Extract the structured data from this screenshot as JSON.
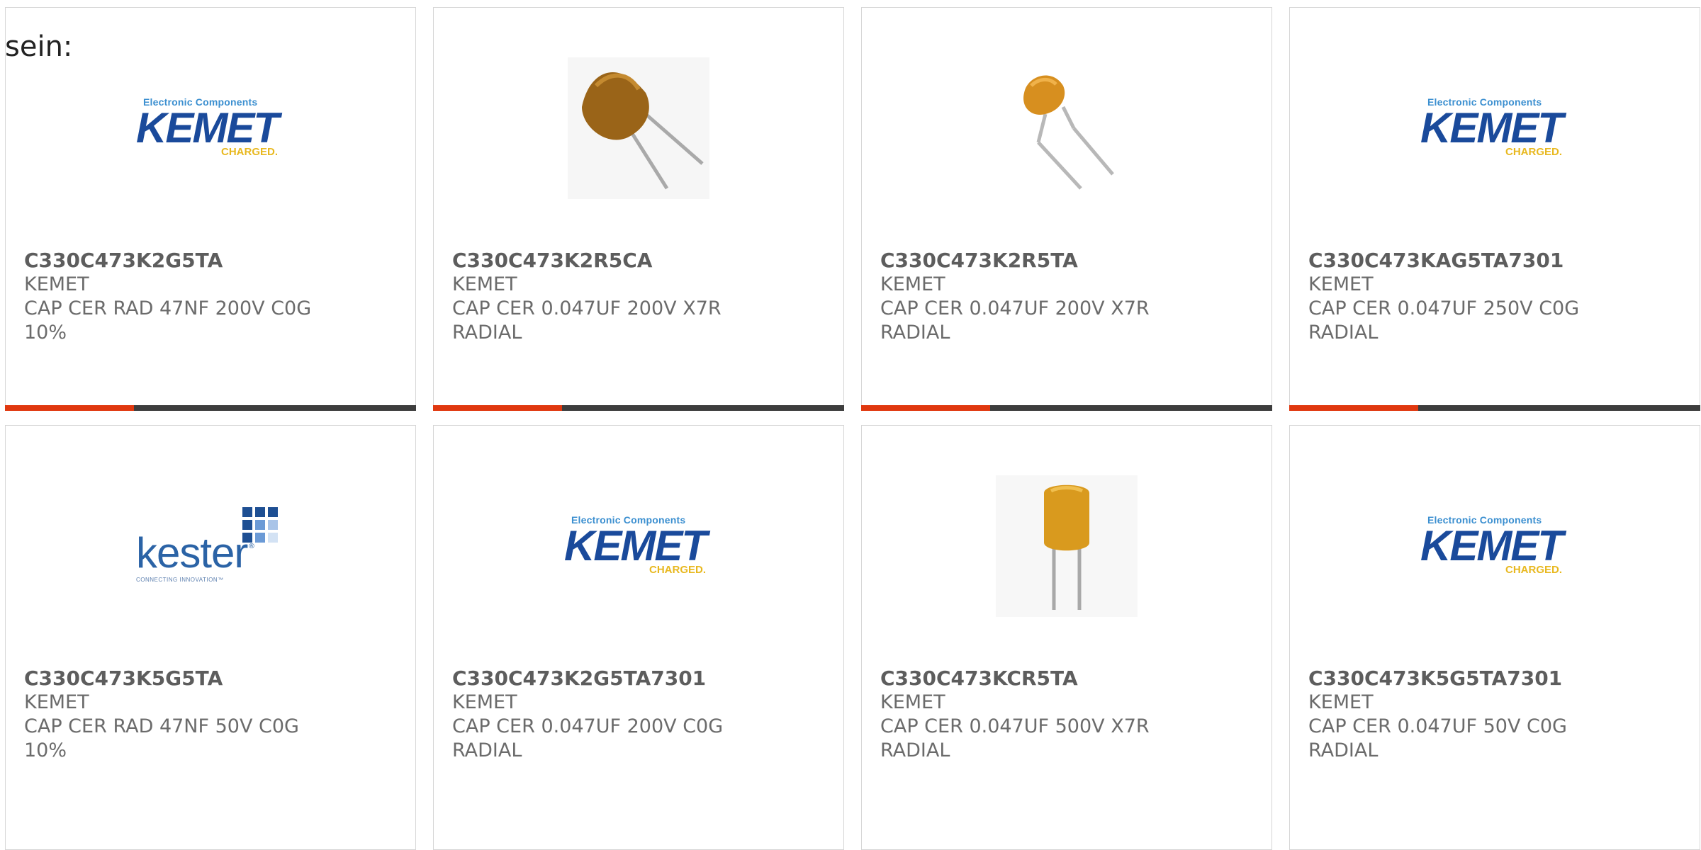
{
  "header": {
    "prefix_text": "sein:"
  },
  "colors": {
    "accent_bar": "#e0380f",
    "bar_base": "#3d3d3d",
    "card_border": "#d6d6d6",
    "text_gray": "#6b6b6b"
  },
  "logos": {
    "kemet": {
      "top": "Electronic Components",
      "word": "KEMET",
      "tag": "CHARGED."
    },
    "kester": {
      "word": "kester",
      "tag": "CONNECTING INNOVATION™"
    }
  },
  "products": [
    {
      "part_number": "C330C473K2G5TA",
      "manufacturer": "KEMET",
      "desc_line1": "CAP CER RAD 47NF 200V C0G",
      "desc_line2": "10%",
      "image": "kemet-logo"
    },
    {
      "part_number": "C330C473K2R5CA",
      "manufacturer": "KEMET",
      "desc_line1": "CAP CER 0.047UF 200V X7R",
      "desc_line2": "RADIAL",
      "image": "capacitor-photo-brown"
    },
    {
      "part_number": "C330C473K2R5TA",
      "manufacturer": "KEMET",
      "desc_line1": "CAP CER 0.047UF 200V X7R",
      "desc_line2": "RADIAL",
      "image": "capacitor-photo-small"
    },
    {
      "part_number": "C330C473KAG5TA7301",
      "manufacturer": "KEMET",
      "desc_line1": "CAP CER 0.047UF 250V C0G",
      "desc_line2": "RADIAL",
      "image": "kemet-logo"
    },
    {
      "part_number": "C330C473K5G5TA",
      "manufacturer": "KEMET",
      "desc_line1": "CAP CER RAD 47NF 50V C0G",
      "desc_line2": "10%",
      "image": "kester-logo"
    },
    {
      "part_number": "C330C473K2G5TA7301",
      "manufacturer": "KEMET",
      "desc_line1": "CAP CER 0.047UF 200V C0G",
      "desc_line2": "RADIAL",
      "image": "kemet-logo"
    },
    {
      "part_number": "C330C473KCR5TA",
      "manufacturer": "KEMET",
      "desc_line1": "CAP CER 0.047UF 500V X7R",
      "desc_line2": "RADIAL",
      "image": "capacitor-photo-upright"
    },
    {
      "part_number": "C330C473K5G5TA7301",
      "manufacturer": "KEMET",
      "desc_line1": "CAP CER 0.047UF 50V C0G",
      "desc_line2": "RADIAL",
      "image": "kemet-logo"
    }
  ]
}
